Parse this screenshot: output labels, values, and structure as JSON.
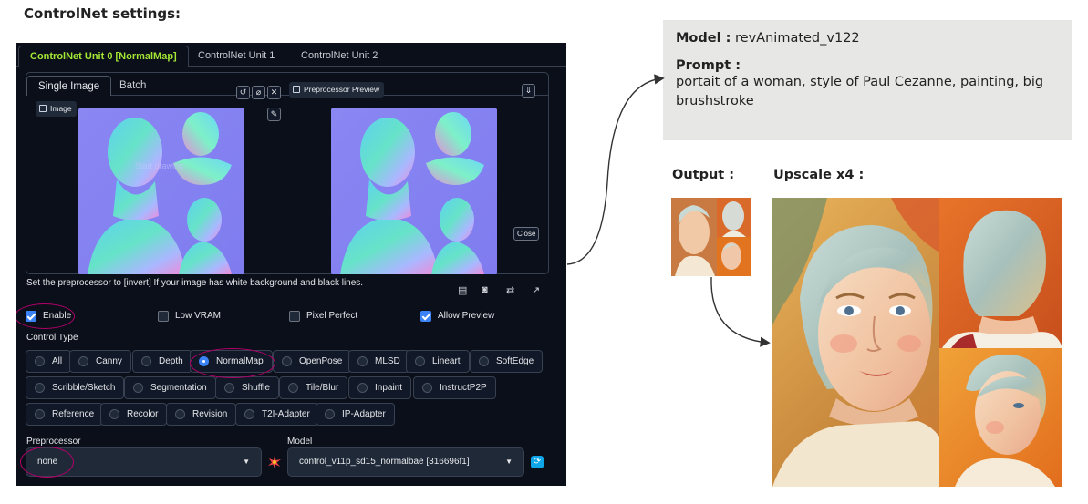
{
  "heading": "ControlNet settings:",
  "controlnet": {
    "unit_tabs": [
      "ControlNet Unit 0 [NormalMap]",
      "ControlNet Unit 1",
      "ControlNet Unit 2"
    ],
    "sub_tabs": [
      "Single Image",
      "Batch"
    ],
    "image_label": "Image",
    "preview_label": "Preprocessor Preview",
    "close_label": "Close",
    "watermark": "Start drawing",
    "hint": "Set the preprocessor to [invert] If your image has white background and black lines.",
    "checkboxes": [
      {
        "label": "Enable",
        "checked": true
      },
      {
        "label": "Low VRAM",
        "checked": false
      },
      {
        "label": "Pixel Perfect",
        "checked": false
      },
      {
        "label": "Allow Preview",
        "checked": true
      }
    ],
    "control_type_label": "Control Type",
    "control_types": [
      "All",
      "Canny",
      "Depth",
      "NormalMap",
      "OpenPose",
      "MLSD",
      "Lineart",
      "SoftEdge",
      "Scribble/Sketch",
      "Segmentation",
      "Shuffle",
      "Tile/Blur",
      "Inpaint",
      "InstructP2P",
      "Reference",
      "Recolor",
      "Revision",
      "T2I-Adapter",
      "IP-Adapter"
    ],
    "selected_control_type": "NormalMap",
    "preprocessor_label": "Preprocessor",
    "preprocessor_value": "none",
    "model_label": "Model",
    "model_value": "control_v11p_sd15_normalbae [316696f1]",
    "accent_color": "#a3e635",
    "highlight_color": "#b3006b"
  },
  "info": {
    "model_key": "Model :",
    "model_value": "revAnimated_v122",
    "prompt_key": "Prompt :",
    "prompt_value": "portait of a woman, style of Paul Cezanne, painting, big brushstroke"
  },
  "output_label": "Output :",
  "upscale_label": "Upscale x4 :"
}
